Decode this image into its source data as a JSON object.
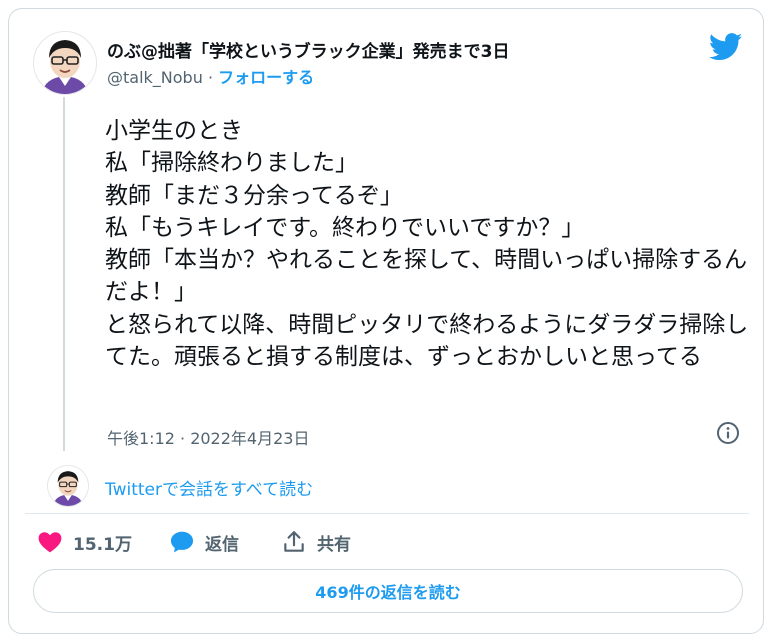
{
  "author": {
    "display_name": "のぶ@拙著「学校というブラック企業」発売まで3日",
    "handle": "@talk_Nobu",
    "separator": "·",
    "follow_label": "フォローする"
  },
  "tweet": {
    "text": "小学生のとき\n私「掃除終わりました」\n教師「まだ３分余ってるぞ」\n私「もうキレイです。終わりでいいですか？」\n教師「本当か？やれることを探して、時間いっぱい掃除するんだよ！」\nと怒られて以降、時間ピッタリで終わるようにダラダラ掃除してた。頑張ると損する制度は、ずっとおかしいと思ってる",
    "timestamp": "午後1:12 · 2022年4月23日"
  },
  "conversation_link": "Twitterで会話をすべて読む",
  "actions": {
    "like_count": "15.1万",
    "reply_label": "返信",
    "share_label": "共有"
  },
  "read_replies_button": "469件の返信を読む",
  "colors": {
    "accent": "#1d9bf0",
    "like": "#f91880",
    "text": "#0f1419",
    "muted": "#536471"
  },
  "icons": {
    "brand": "twitter-bird-icon",
    "info": "info-icon",
    "like": "heart-icon",
    "reply": "speech-bubble-icon",
    "share": "share-upload-icon"
  }
}
